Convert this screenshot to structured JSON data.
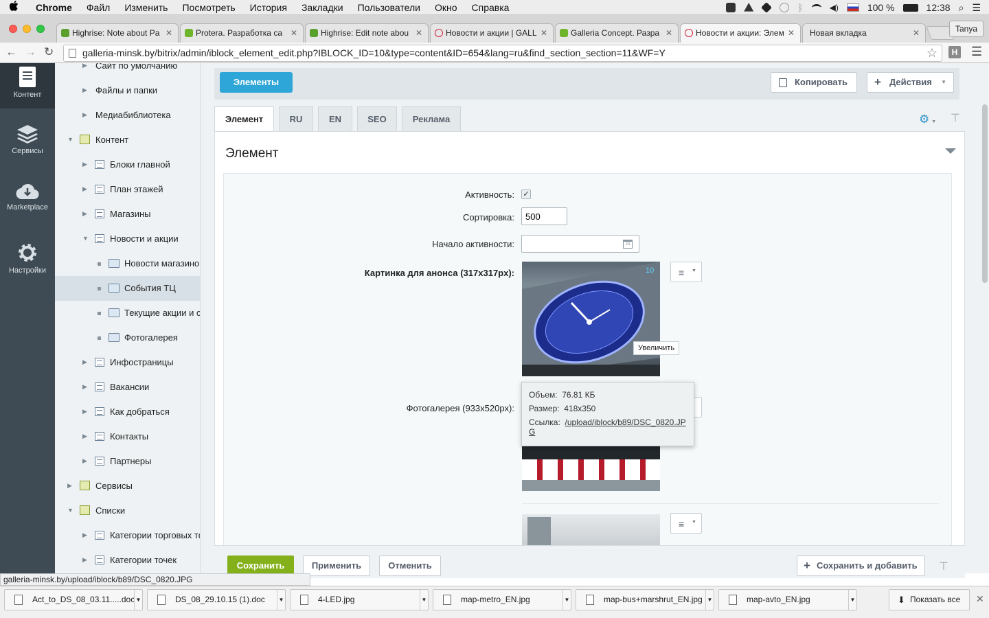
{
  "menubar": {
    "app": "Chrome",
    "items": [
      "Файл",
      "Изменить",
      "Посмотреть",
      "История",
      "Закладки",
      "Пользователи",
      "Окно",
      "Справка"
    ],
    "battery": "100 %",
    "time": "12:38"
  },
  "tabs": [
    {
      "title": "Highrise: Note about Pa",
      "favicon_color": "#5aa02c"
    },
    {
      "title": "Protera. Разработка са",
      "favicon_color": "#6fb52c"
    },
    {
      "title": "Highrise: Edit note abou",
      "favicon_color": "#5aa02c"
    },
    {
      "title": "Новости и акции | GALL",
      "favicon_color": "#d21f3c"
    },
    {
      "title": "Galleria Concept. Разра",
      "favicon_color": "#6fb52c"
    },
    {
      "title": "Новости и акции: Элем",
      "favicon_color": "#d21f3c",
      "active": true
    },
    {
      "title": "Новая вкладка",
      "favicon_color": ""
    }
  ],
  "profile": "Tanya",
  "url": "galleria-minsk.by/bitrix/admin/iblock_element_edit.php?IBLOCK_ID=10&type=content&ID=654&lang=ru&find_section_section=11&WF=Y",
  "adminbar": [
    {
      "label": "Контент",
      "icon": "document-icon"
    },
    {
      "label": "Сервисы",
      "icon": "layers-icon"
    },
    {
      "label": "Marketplace",
      "icon": "cloud-download-icon"
    },
    {
      "label": "Настройки",
      "icon": "gear-icon"
    }
  ],
  "tree": [
    {
      "label": "Сайт по умолчанию",
      "level": 1,
      "icon": "none"
    },
    {
      "label": "Файлы и папки",
      "level": 1,
      "icon": "none"
    },
    {
      "label": "Медиабиблиотека",
      "level": 1,
      "icon": "none"
    },
    {
      "label": "Контент",
      "level": 0,
      "icon": "group"
    },
    {
      "label": "Блоки главной",
      "level": 1,
      "icon": "list"
    },
    {
      "label": "План этажей",
      "level": 1,
      "icon": "list"
    },
    {
      "label": "Магазины",
      "level": 1,
      "icon": "list"
    },
    {
      "label": "Новости и акции",
      "level": 1,
      "icon": "list"
    },
    {
      "label": "Новости магазинов",
      "level": 2,
      "icon": "folder"
    },
    {
      "label": "События ТЦ",
      "level": 2,
      "icon": "folder",
      "selected": true
    },
    {
      "label": "Текущие акции и скидки",
      "level": 2,
      "icon": "folder"
    },
    {
      "label": "Фотогалерея",
      "level": 2,
      "icon": "folder"
    },
    {
      "label": "Инфостраницы",
      "level": 1,
      "icon": "list"
    },
    {
      "label": "Вакансии",
      "level": 1,
      "icon": "list"
    },
    {
      "label": "Как добраться",
      "level": 1,
      "icon": "list"
    },
    {
      "label": "Контакты",
      "level": 1,
      "icon": "list"
    },
    {
      "label": "Партнеры",
      "level": 1,
      "icon": "list"
    },
    {
      "label": "Сервисы",
      "level": 0,
      "icon": "group"
    },
    {
      "label": "Списки",
      "level": 0,
      "icon": "group"
    },
    {
      "label": "Категории торговых точек",
      "level": 1,
      "icon": "list"
    },
    {
      "label": "Категории точек",
      "level": 1,
      "icon": "list"
    }
  ],
  "top_actions": {
    "elements": "Элементы",
    "copy": "Копировать",
    "actions": "Действия"
  },
  "form_tabs": [
    "Элемент",
    "RU",
    "EN",
    "SEO",
    "Реклама"
  ],
  "section_title": "Элемент",
  "fields": {
    "active_label": "Активность:",
    "sort_label": "Сортировка:",
    "sort_value": "500",
    "start_label": "Начало активности:",
    "start_value": "",
    "preview_label": "Картинка для анонса (317x317px):",
    "gallery_label": "Фотогалерея (933x520px):"
  },
  "tooltip": {
    "zoom": "Увеличить",
    "volume_label": "Объем:",
    "volume_value": "76.81 КБ",
    "size_label": "Размер:",
    "size_value": "418x350",
    "link_label": "Ссылка:",
    "link_value": "/upload/iblock/b89/DSC_0820.JPG"
  },
  "bottom_actions": {
    "save": "Сохранить",
    "apply": "Применить",
    "cancel": "Отменить",
    "save_add": "Сохранить и добавить"
  },
  "status_url": "galleria-minsk.by/upload/iblock/b89/DSC_0820.JPG",
  "downloads": [
    "Act_to_DS_08_03.11.....doc",
    "DS_08_29.10.15 (1).doc",
    "4-LED.jpg",
    "map-metro_EN.jpg",
    "map-bus+marshrut_EN.jpg",
    "map-avto_EN.jpg"
  ],
  "show_all": "Показать все",
  "colors": {
    "accent_blue": "#2fa6d8",
    "save_green": "#84b01b",
    "admin_panel": "#3f4b54"
  }
}
